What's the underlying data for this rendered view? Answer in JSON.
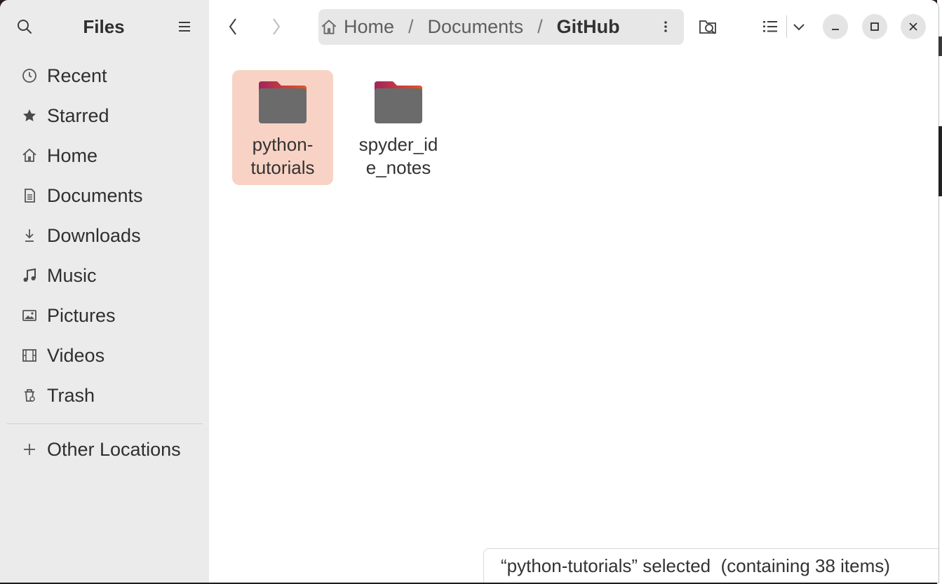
{
  "sidebar": {
    "title": "Files",
    "items": [
      {
        "label": "Recent",
        "icon": "clock-icon"
      },
      {
        "label": "Starred",
        "icon": "star-icon"
      },
      {
        "label": "Home",
        "icon": "home-icon"
      },
      {
        "label": "Documents",
        "icon": "document-icon"
      },
      {
        "label": "Downloads",
        "icon": "download-icon"
      },
      {
        "label": "Music",
        "icon": "music-icon"
      },
      {
        "label": "Pictures",
        "icon": "picture-icon"
      },
      {
        "label": "Videos",
        "icon": "video-icon"
      },
      {
        "label": "Trash",
        "icon": "trash-icon"
      }
    ],
    "other_locations": "Other Locations"
  },
  "pathbar": {
    "crumbs": [
      "Home",
      "Documents",
      "GitHub"
    ],
    "separator": "/"
  },
  "files": [
    {
      "name": "python-\ntutorials",
      "selected": true
    },
    {
      "name": "spyder_id\ne_notes",
      "selected": false
    }
  ],
  "status": {
    "text": "“python-tutorials” selected  (containing 38 items)"
  },
  "colors": {
    "selection": "#f8d3c5",
    "folder_body": "#6b6b6b",
    "folder_tab_gradient_start": "#a3235f",
    "folder_tab_gradient_end": "#e95420"
  }
}
